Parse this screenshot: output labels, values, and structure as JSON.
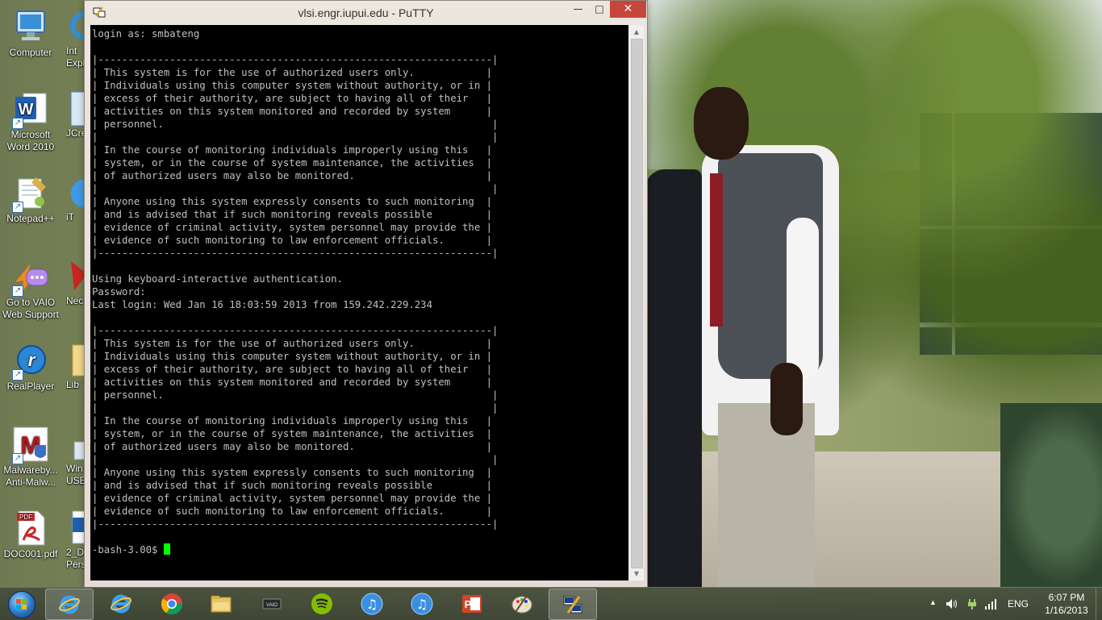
{
  "window": {
    "title": "vlsi.engr.iupui.edu - PuTTY",
    "minimize_symbol": "—",
    "maximize_symbol": "□",
    "close_symbol": "✕"
  },
  "terminal": {
    "lines": [
      "login as: smbateng",
      "",
      "|------------------------------------------------------------------|",
      "| This system is for the use of authorized users only.            |",
      "| Individuals using this computer system without authority, or in |",
      "| excess of their authority, are subject to having all of their   |",
      "| activities on this system monitored and recorded by system      |",
      "| personnel.                                                       |",
      "|                                                                  |",
      "| In the course of monitoring individuals improperly using this   |",
      "| system, or in the course of system maintenance, the activities  |",
      "| of authorized users may also be monitored.                      |",
      "|                                                                  |",
      "| Anyone using this system expressly consents to such monitoring  |",
      "| and is advised that if such monitoring reveals possible         |",
      "| evidence of criminal activity, system personnel may provide the |",
      "| evidence of such monitoring to law enforcement officials.       |",
      "|------------------------------------------------------------------|",
      "",
      "Using keyboard-interactive authentication.",
      "Password:",
      "Last login: Wed Jan 16 18:03:59 2013 from 159.242.229.234",
      "",
      "|------------------------------------------------------------------|",
      "| This system is for the use of authorized users only.            |",
      "| Individuals using this computer system without authority, or in |",
      "| excess of their authority, are subject to having all of their   |",
      "| activities on this system monitored and recorded by system      |",
      "| personnel.                                                       |",
      "|                                                                  |",
      "| In the course of monitoring individuals improperly using this   |",
      "| system, or in the course of system maintenance, the activities  |",
      "| of authorized users may also be monitored.                      |",
      "|                                                                  |",
      "| Anyone using this system expressly consents to such monitoring  |",
      "| and is advised that if such monitoring reveals possible         |",
      "| evidence of criminal activity, system personnel may provide the |",
      "| evidence of such monitoring to law enforcement officials.       |",
      "|------------------------------------------------------------------|",
      ""
    ],
    "prompt": "-bash-3.00$ ",
    "text_color": "#c0c0c0",
    "cursor_color": "#00ff00",
    "background": "#000000"
  },
  "desktop_icons": [
    {
      "name": "computer-icon",
      "label": "Computer"
    },
    {
      "name": "internet-explorer-icon",
      "label": "Int\nExpl"
    },
    {
      "name": "word-2010-icon",
      "label": "Microsoft\nWord 2010"
    },
    {
      "name": "jcreator-icon",
      "label": "JCre"
    },
    {
      "name": "notepad-plus-plus-icon",
      "label": "Notepad++"
    },
    {
      "name": "itunes-icon",
      "label": "iT"
    },
    {
      "name": "vaio-support-icon",
      "label": "Go to VAIO\nWeb Support"
    },
    {
      "name": "nec-icon",
      "label": "Nec"
    },
    {
      "name": "realplayer-icon",
      "label": "RealPlayer"
    },
    {
      "name": "libraries-icon",
      "label": "Lib"
    },
    {
      "name": "malwarebytes-icon",
      "label": "Malwareby...\nAnti-Malw..."
    },
    {
      "name": "windows-usb-icon",
      "label": "Win\nUSB"
    },
    {
      "name": "pdf-file-icon",
      "label": "DOC001.pdf"
    },
    {
      "name": "word-doc-icon",
      "label": "2_DC\nPers"
    }
  ],
  "taskbar": {
    "items": [
      {
        "name": "taskbar-start-button"
      },
      {
        "name": "taskbar-internet-explorer",
        "active": true
      },
      {
        "name": "taskbar-internet-explorer-pinned"
      },
      {
        "name": "taskbar-chrome"
      },
      {
        "name": "taskbar-file-explorer"
      },
      {
        "name": "taskbar-vaio"
      },
      {
        "name": "taskbar-spotify"
      },
      {
        "name": "taskbar-itunes"
      },
      {
        "name": "taskbar-itunes-2"
      },
      {
        "name": "taskbar-powerpoint"
      },
      {
        "name": "taskbar-paint"
      },
      {
        "name": "taskbar-putty",
        "active": true
      }
    ],
    "language": "ENG",
    "time": "6:07 PM",
    "date": "1/16/2013"
  },
  "colors": {
    "titlebar_bg": "#e9e2da",
    "close_button": "#c7463b",
    "taskbar_bg": "#404836"
  }
}
